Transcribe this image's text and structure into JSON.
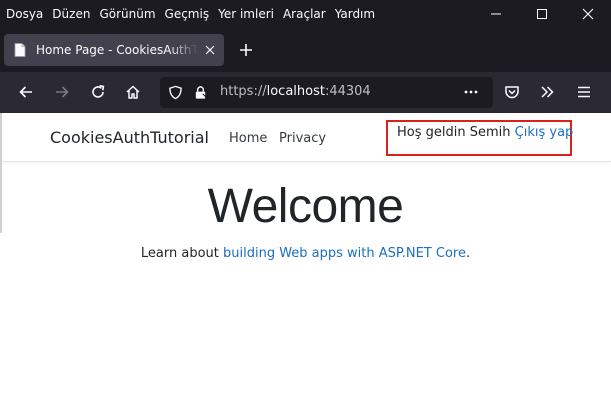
{
  "menubar": {
    "items": [
      {
        "label": "Dosya"
      },
      {
        "label": "Düzen"
      },
      {
        "label": "Görünüm"
      },
      {
        "label": "Geçmiş"
      },
      {
        "label": "Yer imleri"
      },
      {
        "label": "Araçlar"
      },
      {
        "label": "Yardım"
      }
    ]
  },
  "tab": {
    "title": "Home Page - CookiesAuthTutorial",
    "favicon": "page-icon",
    "close_icon": "close-icon",
    "new_tab_icon": "plus-icon"
  },
  "toolbar": {
    "back_icon": "arrow-left-icon",
    "forward_icon": "arrow-right-icon",
    "reload_icon": "reload-icon",
    "home_icon": "home-icon",
    "shield_icon": "shield-icon",
    "lock_icon": "lock-icon",
    "url_scheme": "https://",
    "url_host": "localhost",
    "url_port": ":44304",
    "more_icon": "ellipsis-icon",
    "pocket_icon": "pocket-icon",
    "overflow_icon": "double-chevron-icon",
    "menu_icon": "hamburger-icon"
  },
  "site": {
    "brand": "CookiesAuthTutorial",
    "nav": [
      {
        "label": "Home"
      },
      {
        "label": "Privacy"
      }
    ],
    "welcome": "Hoş geldin Semih",
    "logout": "Çıkış yap",
    "hero_title": "Welcome",
    "hero_prefix": "Learn about ",
    "hero_link": "building Web apps with ASP.NET Core",
    "hero_suffix": "."
  },
  "colors": {
    "frame": "#1c1b22",
    "toolbar": "#2b2a33",
    "link": "#1b6ec2",
    "highlight_box": "#d9221c"
  }
}
